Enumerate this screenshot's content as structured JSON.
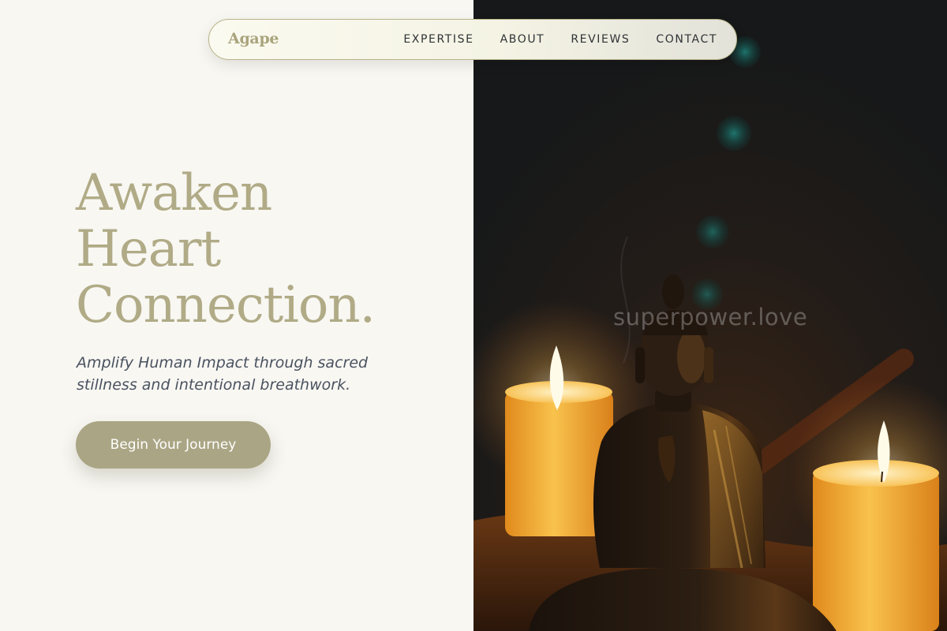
{
  "navbar": {
    "brand": "Agape",
    "links": [
      "EXPERTISE",
      "ABOUT",
      "REVIEWS",
      "CONTACT"
    ]
  },
  "hero": {
    "title_lines": [
      "Awaken",
      "Heart",
      "Connection."
    ],
    "subtitle": "Amplify Human Impact through sacred stillness and intentional breathwork.",
    "cta_label": "Begin Your Journey"
  },
  "image": {
    "watermark": "superpower.love"
  },
  "colors": {
    "accent": "#aaa584",
    "title": "#b0ab86",
    "background": "#f8f7f2",
    "text_muted": "#4a5260"
  }
}
